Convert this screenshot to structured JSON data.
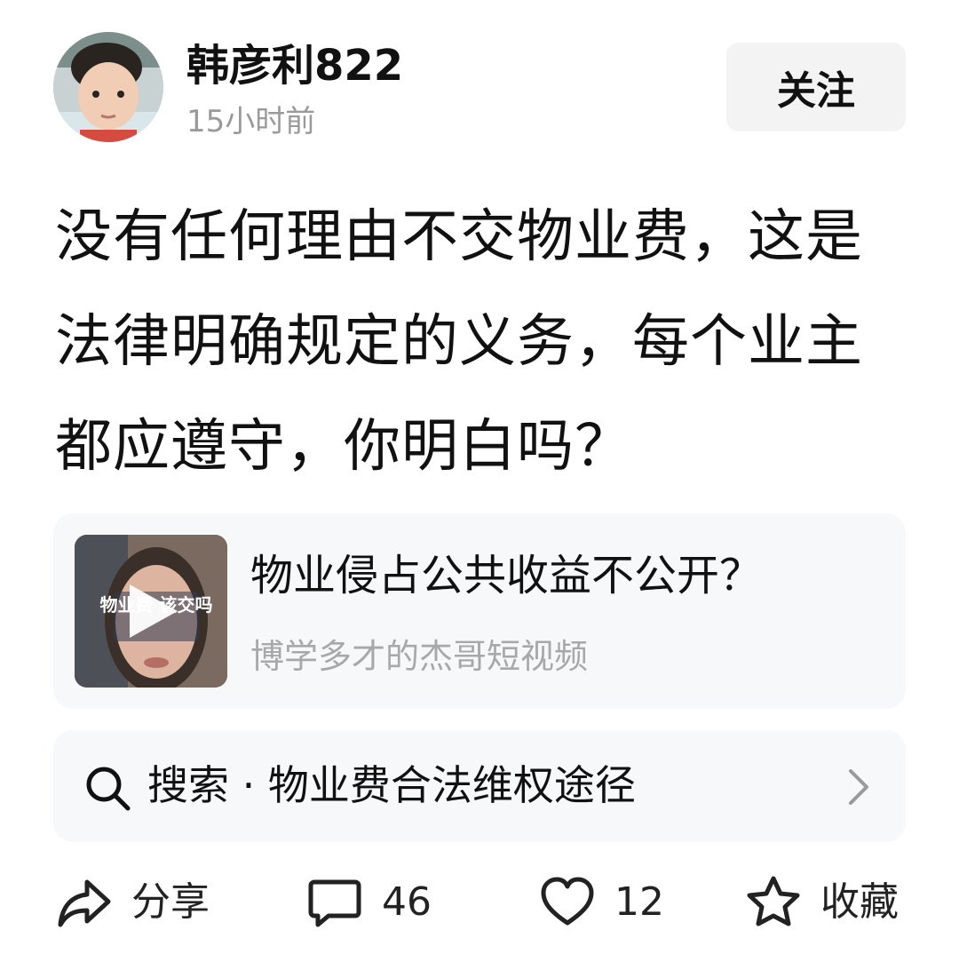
{
  "post": {
    "author_name": "韩彦利822",
    "time": "15小时前",
    "follow_label": "关注",
    "text": "没有任何理由不交物业费，这是法律明确规定的义务，每个业主都应遵守，你明白吗？"
  },
  "video_card": {
    "title": "物业侵占公共收益不公开？",
    "source": "博学多才的杰哥短视频",
    "thumb_caption": "物业费 该交吗"
  },
  "search": {
    "label": "搜索 · 物业费合法维权途径"
  },
  "actions": {
    "share_label": "分享",
    "comment_count": "46",
    "like_count": "12",
    "favorite_label": "收藏"
  },
  "icons": {
    "share": "share-icon",
    "comment": "comment-icon",
    "like": "heart-icon",
    "favorite": "star-icon",
    "search": "search-icon",
    "chevron": "chevron-right-icon",
    "play": "play-icon"
  },
  "colors": {
    "text": "#111111",
    "muted": "#9a9a9a",
    "card_bg": "#f7f8f9",
    "button_bg": "#f3f3f3"
  }
}
